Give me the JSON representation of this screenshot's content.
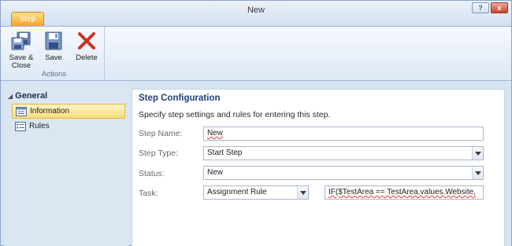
{
  "window": {
    "title": "New"
  },
  "title_bar_buttons": [
    "?",
    "x"
  ],
  "ribbon": {
    "tab": "Step",
    "group_label": "Actions",
    "buttons": [
      {
        "label_line1": "Save &",
        "label_line2": "Close",
        "icon": "save-close-icon"
      },
      {
        "label_line1": "Save",
        "label_line2": "",
        "icon": "save-icon"
      },
      {
        "label_line1": "Delete",
        "label_line2": "",
        "icon": "delete-icon"
      }
    ]
  },
  "nav": {
    "header": "General",
    "items": [
      {
        "label": "Information",
        "selected": true,
        "icon": "information-icon"
      },
      {
        "label": "Rules",
        "selected": false,
        "icon": "rules-icon"
      }
    ]
  },
  "content": {
    "title": "Step Configuration",
    "subtitle": "Specify step settings and rules for entering this step.",
    "fields": {
      "step_name": {
        "label": "Step Name:",
        "value": "New"
      },
      "step_type": {
        "label": "Step Type:",
        "value": "Start Step"
      },
      "status": {
        "label": "Status:",
        "value": "New"
      },
      "task": {
        "label": "Task:",
        "value": "Assignment Rule",
        "expression": "IF($TestArea == TestArea.values.Website,"
      }
    }
  },
  "colors": {
    "tab_orange": "#f3a01b",
    "selected_nav": "#fbdf7c",
    "heading_blue": "#1f3f76",
    "delete_red": "#d0301f"
  }
}
